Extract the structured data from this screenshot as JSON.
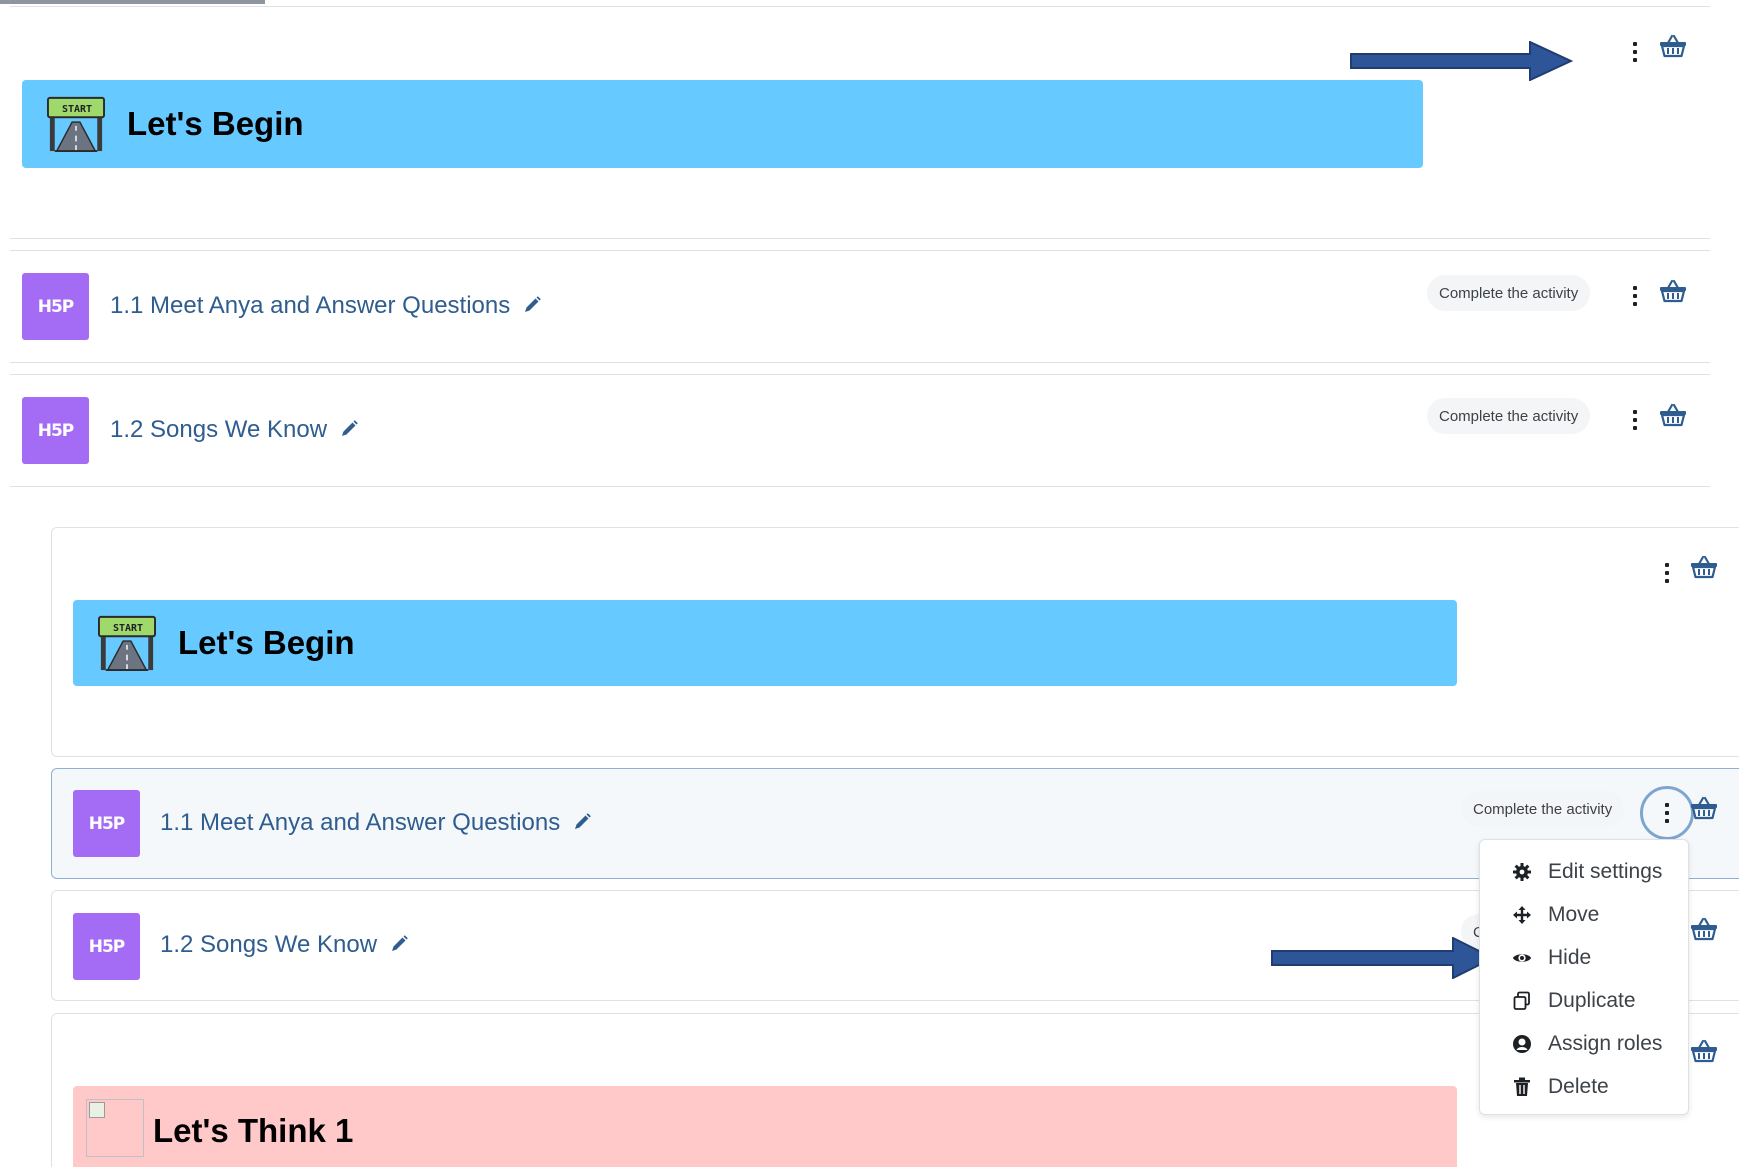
{
  "sections": {
    "top": {
      "banner_title": "Let's Begin",
      "activities": [
        {
          "title": "1.1 Meet Anya and Answer Questions",
          "badge": "Complete the activity"
        },
        {
          "title": "1.2 Songs We Know",
          "badge": "Complete the activity"
        }
      ]
    },
    "indented": {
      "banner_title": "Let's Begin",
      "activities": [
        {
          "title": "1.1 Meet Anya and Answer Questions",
          "badge": "Complete the activity"
        },
        {
          "title": "1.2 Songs We Know",
          "badge": "C"
        }
      ],
      "next_banner_title": "Let's Think 1"
    }
  },
  "hp_label": "H5P",
  "start_sign_text": "START",
  "action_menu": {
    "items": [
      {
        "label": "Edit settings",
        "icon": "gear-icon"
      },
      {
        "label": "Move",
        "icon": "move-arrows-icon"
      },
      {
        "label": "Hide",
        "icon": "eye-icon"
      },
      {
        "label": "Duplicate",
        "icon": "copy-icon"
      },
      {
        "label": "Assign roles",
        "icon": "user-circle-icon"
      },
      {
        "label": "Delete",
        "icon": "trash-icon"
      }
    ]
  },
  "colors": {
    "banner_blue": "#66c9ff",
    "banner_pink": "#ffc9c9",
    "h5p_purple": "#a46bf5",
    "link_blue": "#2f5d8f",
    "arrow_blue": "#2e5597"
  }
}
